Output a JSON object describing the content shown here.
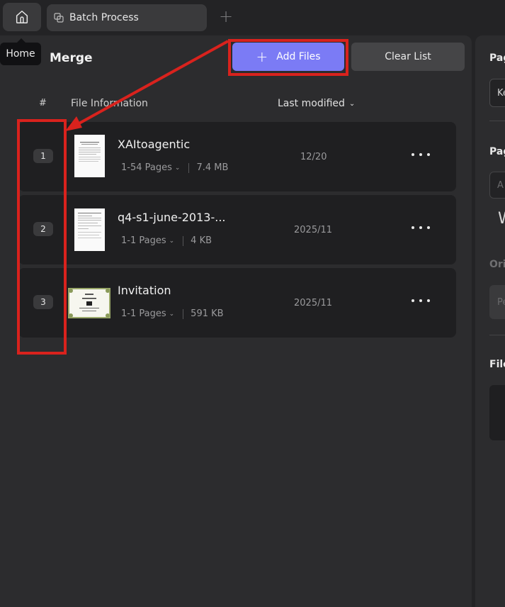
{
  "tabs": {
    "home_tooltip": "Home",
    "active_tab_label": "Batch Process",
    "new_tab_symbol": "+"
  },
  "toolbar": {
    "title": "Merge",
    "add_files_label": "Add Files",
    "clear_list_label": "Clear List"
  },
  "table": {
    "col_index": "#",
    "col_info": "File Information",
    "col_modified": "Last modified",
    "rows": [
      {
        "index": "1",
        "name": "XAItoagentic",
        "pages": "1-54 Pages",
        "size": "7.4 MB",
        "modified": "12/20"
      },
      {
        "index": "2",
        "name": "q4-s1-june-2013-...",
        "pages": "1-1 Pages",
        "size": "4 KB",
        "modified": "2025/11"
      },
      {
        "index": "3",
        "name": "Invitation",
        "pages": "1-1 Pages",
        "size": "591 KB",
        "modified": "2025/11"
      }
    ]
  },
  "side_panel": {
    "label1": "Pag",
    "field1": "Ke",
    "label2": "Pag",
    "field2": "A",
    "big_letter": "W",
    "label3": "Ori",
    "field3": "Pe",
    "label4": "File"
  },
  "colors": {
    "accent": "#7b7bf5",
    "annotation": "#d9221d",
    "background": "#232325",
    "panel": "#2c2c2e",
    "row": "#1f1f21"
  }
}
